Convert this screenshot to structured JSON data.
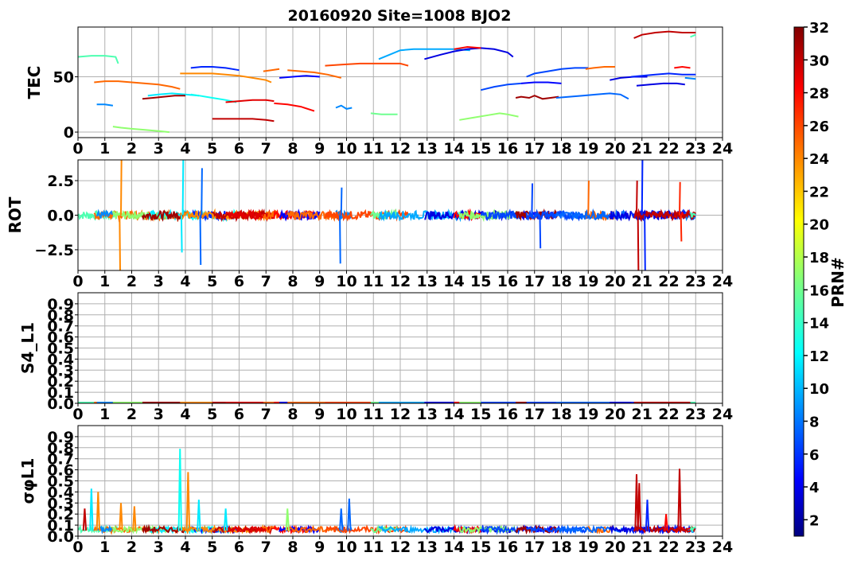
{
  "chart_data": {
    "type": "line",
    "title": "20160920 Site=1008 BJO2",
    "colorbar": {
      "label": "PRN#",
      "range": [
        1,
        32
      ],
      "ticks": [
        2,
        4,
        6,
        8,
        10,
        12,
        14,
        16,
        18,
        20,
        22,
        24,
        26,
        28,
        30,
        32
      ],
      "colormap": "jet"
    },
    "panels": [
      {
        "ylabel": "TEC",
        "ylim": [
          -5,
          95
        ],
        "yticks": [
          0,
          50
        ],
        "ytick_labels": [
          "0",
          "50"
        ],
        "xlim": [
          0,
          24
        ],
        "xticks": [
          0,
          1,
          2,
          3,
          4,
          5,
          6,
          7,
          8,
          9,
          10,
          11,
          12,
          13,
          14,
          15,
          16,
          17,
          18,
          19,
          20,
          21,
          22,
          23,
          24
        ],
        "grid": true,
        "series": [
          {
            "prn": 15,
            "x": [
              0.0,
              0.5,
              1.0,
              1.4,
              1.5
            ],
            "y": [
              68,
              69,
              69,
              68,
              62
            ]
          },
          {
            "prn": 25,
            "x": [
              0.6,
              1.0,
              1.5,
              2.0,
              2.5,
              3.0,
              3.5,
              3.8
            ],
            "y": [
              45,
              46,
              46,
              45,
              44,
              43,
              41,
              39
            ]
          },
          {
            "prn": 9,
            "x": [
              0.7,
              1.0,
              1.3
            ],
            "y": [
              25,
              25,
              24
            ]
          },
          {
            "prn": 17,
            "x": [
              1.3,
              1.6,
              2.0,
              2.5,
              3.0,
              3.4
            ],
            "y": [
              5,
              4,
              3,
              2,
              1,
              0
            ]
          },
          {
            "prn": 12,
            "x": [
              2.6,
              3.0,
              3.5,
              4.0,
              4.5
            ],
            "y": [
              33,
              34,
              35,
              34,
              33
            ]
          },
          {
            "prn": 31,
            "x": [
              2.4,
              2.8,
              3.2,
              3.6,
              4.0
            ],
            "y": [
              30,
              31,
              32,
              33,
              33
            ]
          },
          {
            "prn": 13,
            "x": [
              4.2,
              4.5,
              5.0,
              5.5,
              5.9
            ],
            "y": [
              34,
              33,
              31,
              29,
              27
            ]
          },
          {
            "prn": 6,
            "x": [
              4.2,
              4.6,
              5.0,
              5.5,
              6.0
            ],
            "y": [
              58,
              59,
              59,
              58,
              56
            ]
          },
          {
            "prn": 24,
            "x": [
              3.8,
              4.3,
              5.0,
              5.5,
              6.0,
              6.5,
              7.0,
              7.2
            ],
            "y": [
              53,
              53,
              53,
              52,
              51,
              49,
              47,
              45
            ]
          },
          {
            "prn": 30,
            "x": [
              5.0,
              5.5,
              6.0,
              6.5,
              7.0,
              7.3
            ],
            "y": [
              12,
              12,
              12,
              12,
              11,
              10
            ]
          },
          {
            "prn": 29,
            "x": [
              5.5,
              6.0,
              6.5,
              7.0,
              7.3
            ],
            "y": [
              27,
              28,
              29,
              29,
              28
            ]
          },
          {
            "prn": 25,
            "x": [
              6.9,
              7.2,
              7.5
            ],
            "y": [
              55,
              56,
              57
            ]
          },
          {
            "prn": 28,
            "x": [
              7.3,
              7.8,
              8.3,
              8.8
            ],
            "y": [
              26,
              25,
              23,
              19
            ]
          },
          {
            "prn": 5,
            "x": [
              7.5,
              8.0,
              8.5,
              9.0
            ],
            "y": [
              49,
              50,
              51,
              50
            ]
          },
          {
            "prn": 25,
            "x": [
              7.8,
              8.3,
              8.8,
              9.3,
              9.8
            ],
            "y": [
              56,
              55,
              54,
              52,
              49
            ]
          },
          {
            "prn": 9,
            "x": [
              9.6,
              9.8,
              10.0,
              10.2
            ],
            "y": [
              22,
              24,
              21,
              22
            ]
          },
          {
            "prn": 26,
            "x": [
              9.2,
              9.8,
              10.5,
              11.0,
              11.5,
              12.0,
              12.3
            ],
            "y": [
              60,
              61,
              62,
              62,
              62,
              62,
              60
            ]
          },
          {
            "prn": 16,
            "x": [
              10.9,
              11.3,
              11.9
            ],
            "y": [
              17,
              16,
              16
            ]
          },
          {
            "prn": 10,
            "x": [
              11.2,
              11.6,
              12.0,
              12.5,
              13.0,
              13.5,
              14.0,
              14.6
            ],
            "y": [
              66,
              70,
              74,
              75,
              75,
              75,
              75,
              74
            ]
          },
          {
            "prn": 4,
            "x": [
              12.9,
              13.5,
              14.0,
              14.5,
              15.0,
              15.5,
              16.0,
              16.2
            ],
            "y": [
              66,
              70,
              73,
              75,
              76,
              75,
              72,
              68
            ]
          },
          {
            "prn": 28,
            "x": [
              14.0,
              14.5,
              15.0
            ],
            "y": [
              75,
              77,
              76
            ]
          },
          {
            "prn": 17,
            "x": [
              14.2,
              14.7,
              15.2,
              15.7,
              16.0,
              16.4
            ],
            "y": [
              11,
              13,
              15,
              17,
              16,
              14
            ]
          },
          {
            "prn": 7,
            "x": [
              15.0,
              15.5,
              16.0,
              16.5
            ],
            "y": [
              38,
              41,
              43,
              44
            ]
          },
          {
            "prn": 5,
            "x": [
              16.5,
              17.0,
              17.5,
              18.0
            ],
            "y": [
              44,
              45,
              45,
              44
            ]
          },
          {
            "prn": 31,
            "x": [
              16.3,
              16.5,
              16.8,
              17.0,
              17.3,
              17.6,
              17.9
            ],
            "y": [
              31,
              32,
              31,
              33,
              30,
              31,
              32
            ]
          },
          {
            "prn": 7,
            "x": [
              16.7,
              17.0,
              17.5,
              18.0,
              18.5,
              19.0
            ],
            "y": [
              50,
              53,
              55,
              57,
              58,
              58
            ]
          },
          {
            "prn": 25,
            "x": [
              18.9,
              19.2,
              19.6,
              20.0
            ],
            "y": [
              57,
              58,
              59,
              59
            ]
          },
          {
            "prn": 8,
            "x": [
              17.8,
              18.3,
              18.8,
              19.3,
              19.8,
              20.2,
              20.5
            ],
            "y": [
              31,
              32,
              33,
              34,
              35,
              34,
              30
            ]
          },
          {
            "prn": 4,
            "x": [
              19.8,
              20.2,
              20.7,
              21.2
            ],
            "y": [
              47,
              49,
              50,
              50
            ]
          },
          {
            "prn": 6,
            "x": [
              20.6,
              21.0,
              21.5,
              22.0,
              22.5,
              23.0
            ],
            "y": [
              50,
              51,
              52,
              53,
              52,
              52
            ]
          },
          {
            "prn": 4,
            "x": [
              20.8,
              21.3,
              21.8,
              22.3,
              22.6
            ],
            "y": [
              42,
              43,
              44,
              44,
              43
            ]
          },
          {
            "prn": 9,
            "x": [
              22.6,
              23.0
            ],
            "y": [
              49,
              48
            ]
          },
          {
            "prn": 28,
            "x": [
              22.2,
              22.5,
              22.8
            ],
            "y": [
              58,
              59,
              58
            ]
          },
          {
            "prn": 30,
            "x": [
              20.7,
              21.0,
              21.5,
              22.0,
              22.5,
              23.0
            ],
            "y": [
              85,
              88,
              90,
              91,
              90,
              90
            ]
          },
          {
            "prn": 15,
            "x": [
              22.8,
              23.0
            ],
            "y": [
              86,
              88
            ]
          }
        ]
      },
      {
        "ylabel": "ROT",
        "ylim": [
          -4,
          4
        ],
        "yticks": [
          -2.5,
          0.0,
          2.5
        ],
        "ytick_labels": [
          "−2.5",
          "0.0",
          "2.5"
        ],
        "xlim": [
          0,
          24
        ],
        "xticks": [
          0,
          1,
          2,
          3,
          4,
          5,
          6,
          7,
          8,
          9,
          10,
          11,
          12,
          13,
          14,
          15,
          16,
          17,
          18,
          19,
          20,
          21,
          22,
          23,
          24
        ],
        "grid": true,
        "spikes": [
          {
            "prn": 24,
            "x": 1.6,
            "y": 4.0
          },
          {
            "prn": 24,
            "x": 1.55,
            "y": -4.0
          },
          {
            "prn": 12,
            "x": 3.9,
            "y": 4.0
          },
          {
            "prn": 12,
            "x": 3.85,
            "y": -2.7
          },
          {
            "prn": 8,
            "x": 4.6,
            "y": 3.4
          },
          {
            "prn": 8,
            "x": 4.55,
            "y": -3.6
          },
          {
            "prn": 8,
            "x": 9.8,
            "y": 2.0
          },
          {
            "prn": 8,
            "x": 9.75,
            "y": -3.5
          },
          {
            "prn": 7,
            "x": 16.9,
            "y": 2.3
          },
          {
            "prn": 7,
            "x": 17.2,
            "y": -2.4
          },
          {
            "prn": 25,
            "x": 19.0,
            "y": 2.5
          },
          {
            "prn": 6,
            "x": 21.0,
            "y": 4.0
          },
          {
            "prn": 6,
            "x": 21.1,
            "y": -4.0
          },
          {
            "prn": 30,
            "x": 20.8,
            "y": 2.5
          },
          {
            "prn": 30,
            "x": 20.85,
            "y": -4.0
          },
          {
            "prn": 27,
            "x": 22.4,
            "y": 2.4
          },
          {
            "prn": 27,
            "x": 22.45,
            "y": -1.9
          }
        ]
      },
      {
        "ylabel": "S4_L1",
        "ylim": [
          0.0,
          1.0
        ],
        "yticks": [
          0.0,
          0.1,
          0.2,
          0.3,
          0.4,
          0.5,
          0.6,
          0.7,
          0.8,
          0.9
        ],
        "ytick_labels": [
          "0.0",
          "0.1",
          "0.2",
          "0.3",
          "0.4",
          "0.5",
          "0.6",
          "0.7",
          "0.8",
          "0.9"
        ],
        "xlim": [
          0,
          24
        ],
        "xticks": [
          0,
          1,
          2,
          3,
          4,
          5,
          6,
          7,
          8,
          9,
          10,
          11,
          12,
          13,
          14,
          15,
          16,
          17,
          18,
          19,
          20,
          21,
          22,
          23,
          24
        ],
        "grid": true,
        "baseline_value": 0.0
      },
      {
        "ylabel": "σφL1",
        "ylim": [
          0.0,
          1.0
        ],
        "yticks": [
          0.0,
          0.1,
          0.2,
          0.3,
          0.4,
          0.5,
          0.6,
          0.7,
          0.8,
          0.9
        ],
        "ytick_labels": [
          "0.0",
          "0.1",
          "0.2",
          "0.3",
          "0.4",
          "0.5",
          "0.6",
          "0.7",
          "0.8",
          "0.9"
        ],
        "xlim": [
          0,
          24
        ],
        "xticks": [
          0,
          1,
          2,
          3,
          4,
          5,
          6,
          7,
          8,
          9,
          10,
          11,
          12,
          13,
          14,
          15,
          16,
          17,
          18,
          19,
          20,
          21,
          22,
          23,
          24
        ],
        "grid": true,
        "baseline_value": 0.05,
        "spikes": [
          {
            "prn": 30,
            "x": 0.25,
            "y": 0.25
          },
          {
            "prn": 12,
            "x": 0.5,
            "y": 0.43
          },
          {
            "prn": 24,
            "x": 0.75,
            "y": 0.4
          },
          {
            "prn": 24,
            "x": 1.6,
            "y": 0.3
          },
          {
            "prn": 24,
            "x": 2.1,
            "y": 0.27
          },
          {
            "prn": 13,
            "x": 3.8,
            "y": 0.79
          },
          {
            "prn": 24,
            "x": 4.1,
            "y": 0.58
          },
          {
            "prn": 12,
            "x": 4.5,
            "y": 0.33
          },
          {
            "prn": 12,
            "x": 5.5,
            "y": 0.25
          },
          {
            "prn": 17,
            "x": 7.8,
            "y": 0.25
          },
          {
            "prn": 8,
            "x": 9.8,
            "y": 0.25
          },
          {
            "prn": 8,
            "x": 10.1,
            "y": 0.34
          },
          {
            "prn": 30,
            "x": 20.8,
            "y": 0.56
          },
          {
            "prn": 30,
            "x": 20.9,
            "y": 0.48
          },
          {
            "prn": 6,
            "x": 21.2,
            "y": 0.33
          },
          {
            "prn": 28,
            "x": 21.9,
            "y": 0.2
          },
          {
            "prn": 30,
            "x": 22.4,
            "y": 0.61
          }
        ]
      }
    ]
  }
}
